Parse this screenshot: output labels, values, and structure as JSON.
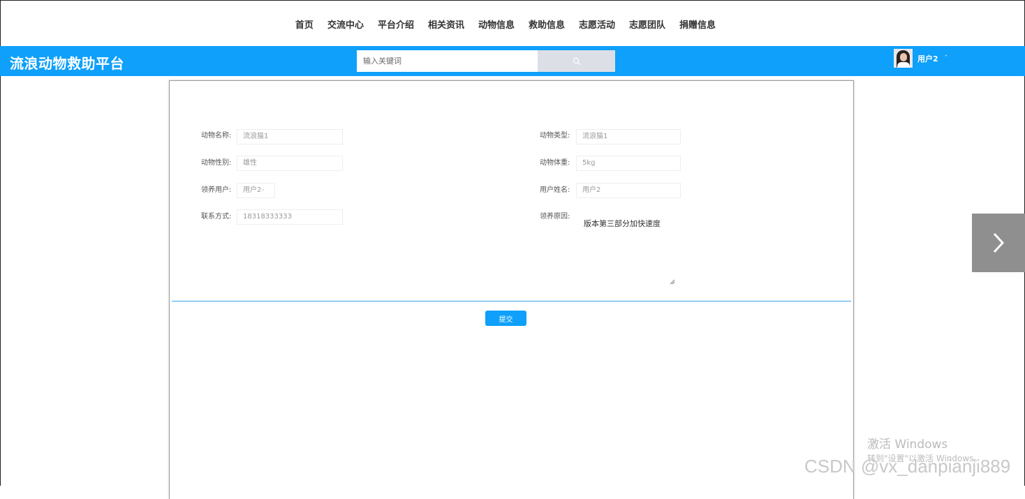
{
  "nav": [
    "首页",
    "交流中心",
    "平台介绍",
    "相关资讯",
    "动物信息",
    "救助信息",
    "志愿活动",
    "志愿团队",
    "捐赠信息"
  ],
  "header": {
    "site_title": "流浪动物救助平台",
    "search_placeholder": "输入关键词",
    "user_name": "用户2",
    "caret": "ˇ",
    "accent_color": "#0ea0fa"
  },
  "form": {
    "animal_name": {
      "label": "动物名称:",
      "value": "流浪猫1"
    },
    "animal_type": {
      "label": "动物类型:",
      "value": "流浪猫1"
    },
    "animal_gender": {
      "label": "动物性别:",
      "value": "雄性"
    },
    "animal_weight": {
      "label": "动物体重:",
      "value": "5kg"
    },
    "adopt_user": {
      "label": "领养用户:",
      "value": "用户2-"
    },
    "user_fullname": {
      "label": "用户姓名:",
      "value": "用户2"
    },
    "contact": {
      "label": "联系方式:",
      "value": "18318333333"
    },
    "adopt_reason": {
      "label": "领养原因:",
      "value": "版本第三部分加快速度"
    },
    "submit_label": "提交"
  },
  "watermarks": {
    "windows_line1": "激活 Windows",
    "windows_line2": "转到\"设置\"以激活 Windows。",
    "csdn": "CSDN @vx_danpianji889"
  }
}
